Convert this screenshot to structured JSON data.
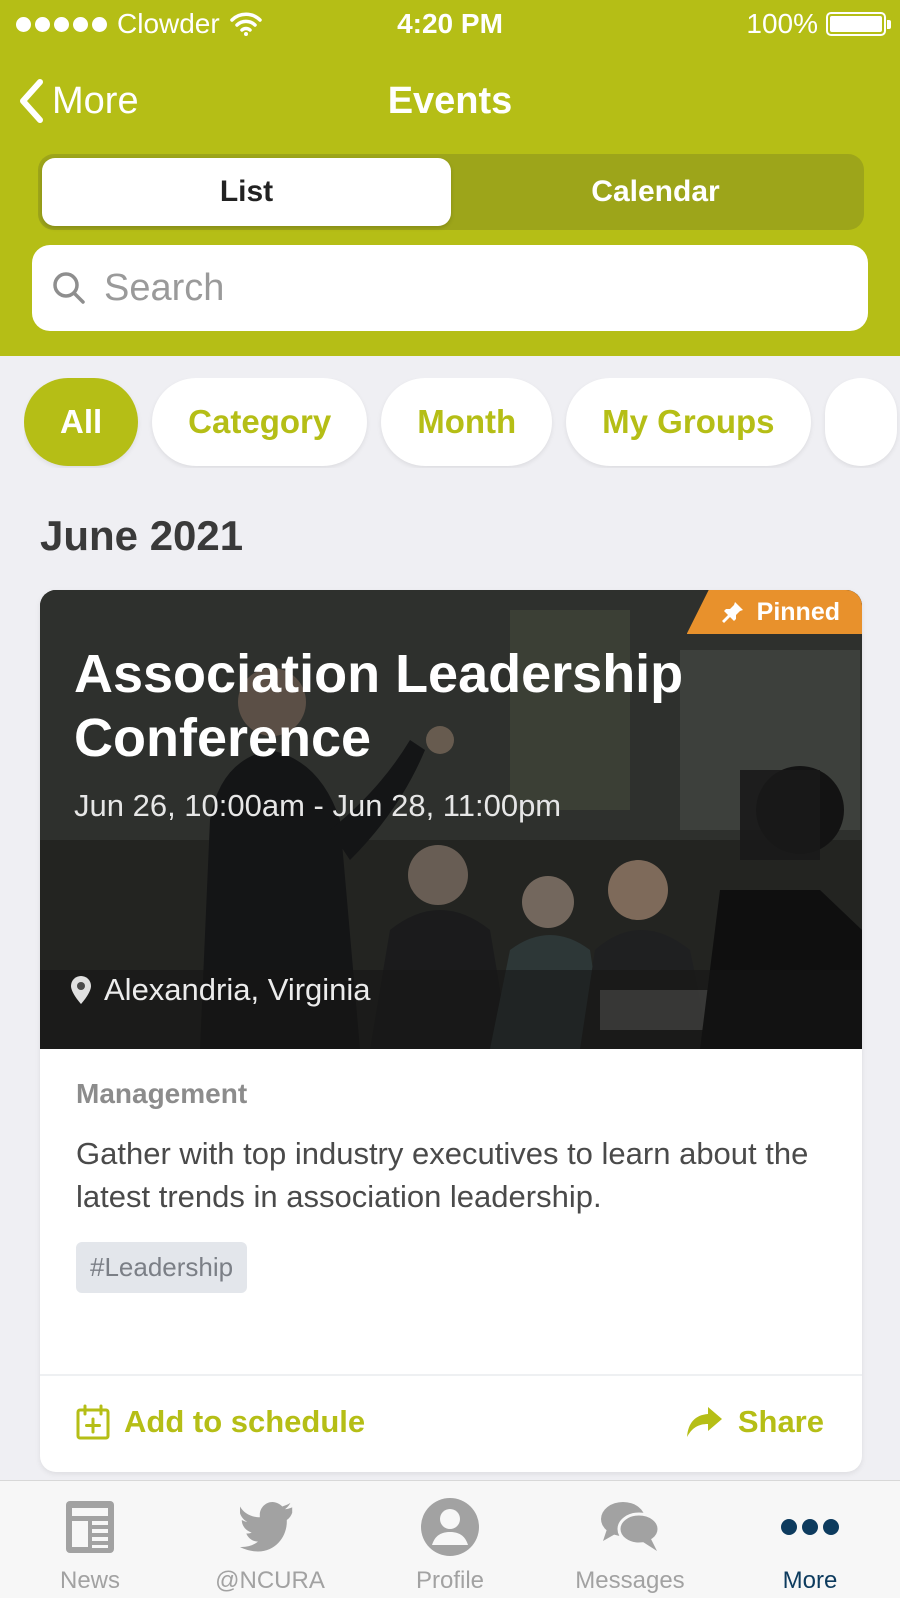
{
  "status": {
    "carrier": "Clowder",
    "time": "4:20 PM",
    "battery": "100%"
  },
  "nav": {
    "back_label": "More",
    "title": "Events"
  },
  "view_toggle": {
    "options": [
      "List",
      "Calendar"
    ],
    "selected": "List"
  },
  "search": {
    "placeholder": "Search"
  },
  "filters": [
    "All",
    "Category",
    "Month",
    "My Groups"
  ],
  "section": {
    "month": "June 2021"
  },
  "event": {
    "pinned_label": "Pinned",
    "title": "Association Leadership Conference",
    "date_range": "Jun 26, 10:00am - Jun 28, 11:00pm",
    "location": "Alexandria, Virginia",
    "category": "Management",
    "description": "Gather with top industry executives to learn about the latest trends in association leadership.",
    "tag": "#Leadership",
    "add_label": "Add to schedule",
    "share_label": "Share"
  },
  "tabbar": {
    "items": [
      {
        "label": "News",
        "icon": "news-icon"
      },
      {
        "label": "@NCURA",
        "icon": "twitter-icon"
      },
      {
        "label": "Profile",
        "icon": "profile-icon"
      },
      {
        "label": "Messages",
        "icon": "messages-icon"
      },
      {
        "label": "More",
        "icon": "more-icon"
      }
    ],
    "active": "More"
  },
  "colors": {
    "brand": "#b5be16",
    "pinned": "#e8912c",
    "tab_active": "#0d3b5e"
  }
}
